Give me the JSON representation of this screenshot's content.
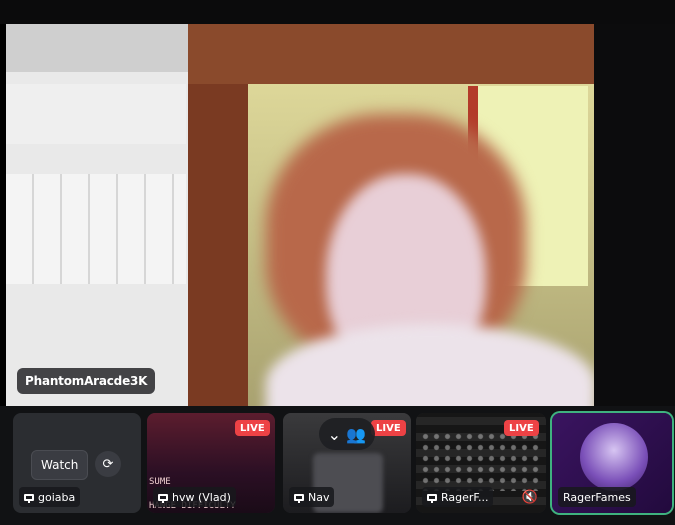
{
  "main_stream": {
    "streamer_name": "PhantomAracde3K"
  },
  "tiles": [
    {
      "user": "goiaba",
      "watch_label": "Watch",
      "live": false
    },
    {
      "user": "hvw (Vlad)",
      "live": true,
      "live_label": "LIVE",
      "overlay_text_1": "SUME",
      "overlay_text_2": "HANGE DIFFICULTY"
    },
    {
      "user": "Nav",
      "live": true,
      "live_label": "LIVE"
    },
    {
      "user": "RagerF...",
      "live": true,
      "live_label": "LIVE"
    },
    {
      "user": "RagerFames",
      "live": false,
      "selected": true
    }
  ],
  "colors": {
    "live": "#ed4245",
    "selected_outline": "#3fb27f"
  }
}
